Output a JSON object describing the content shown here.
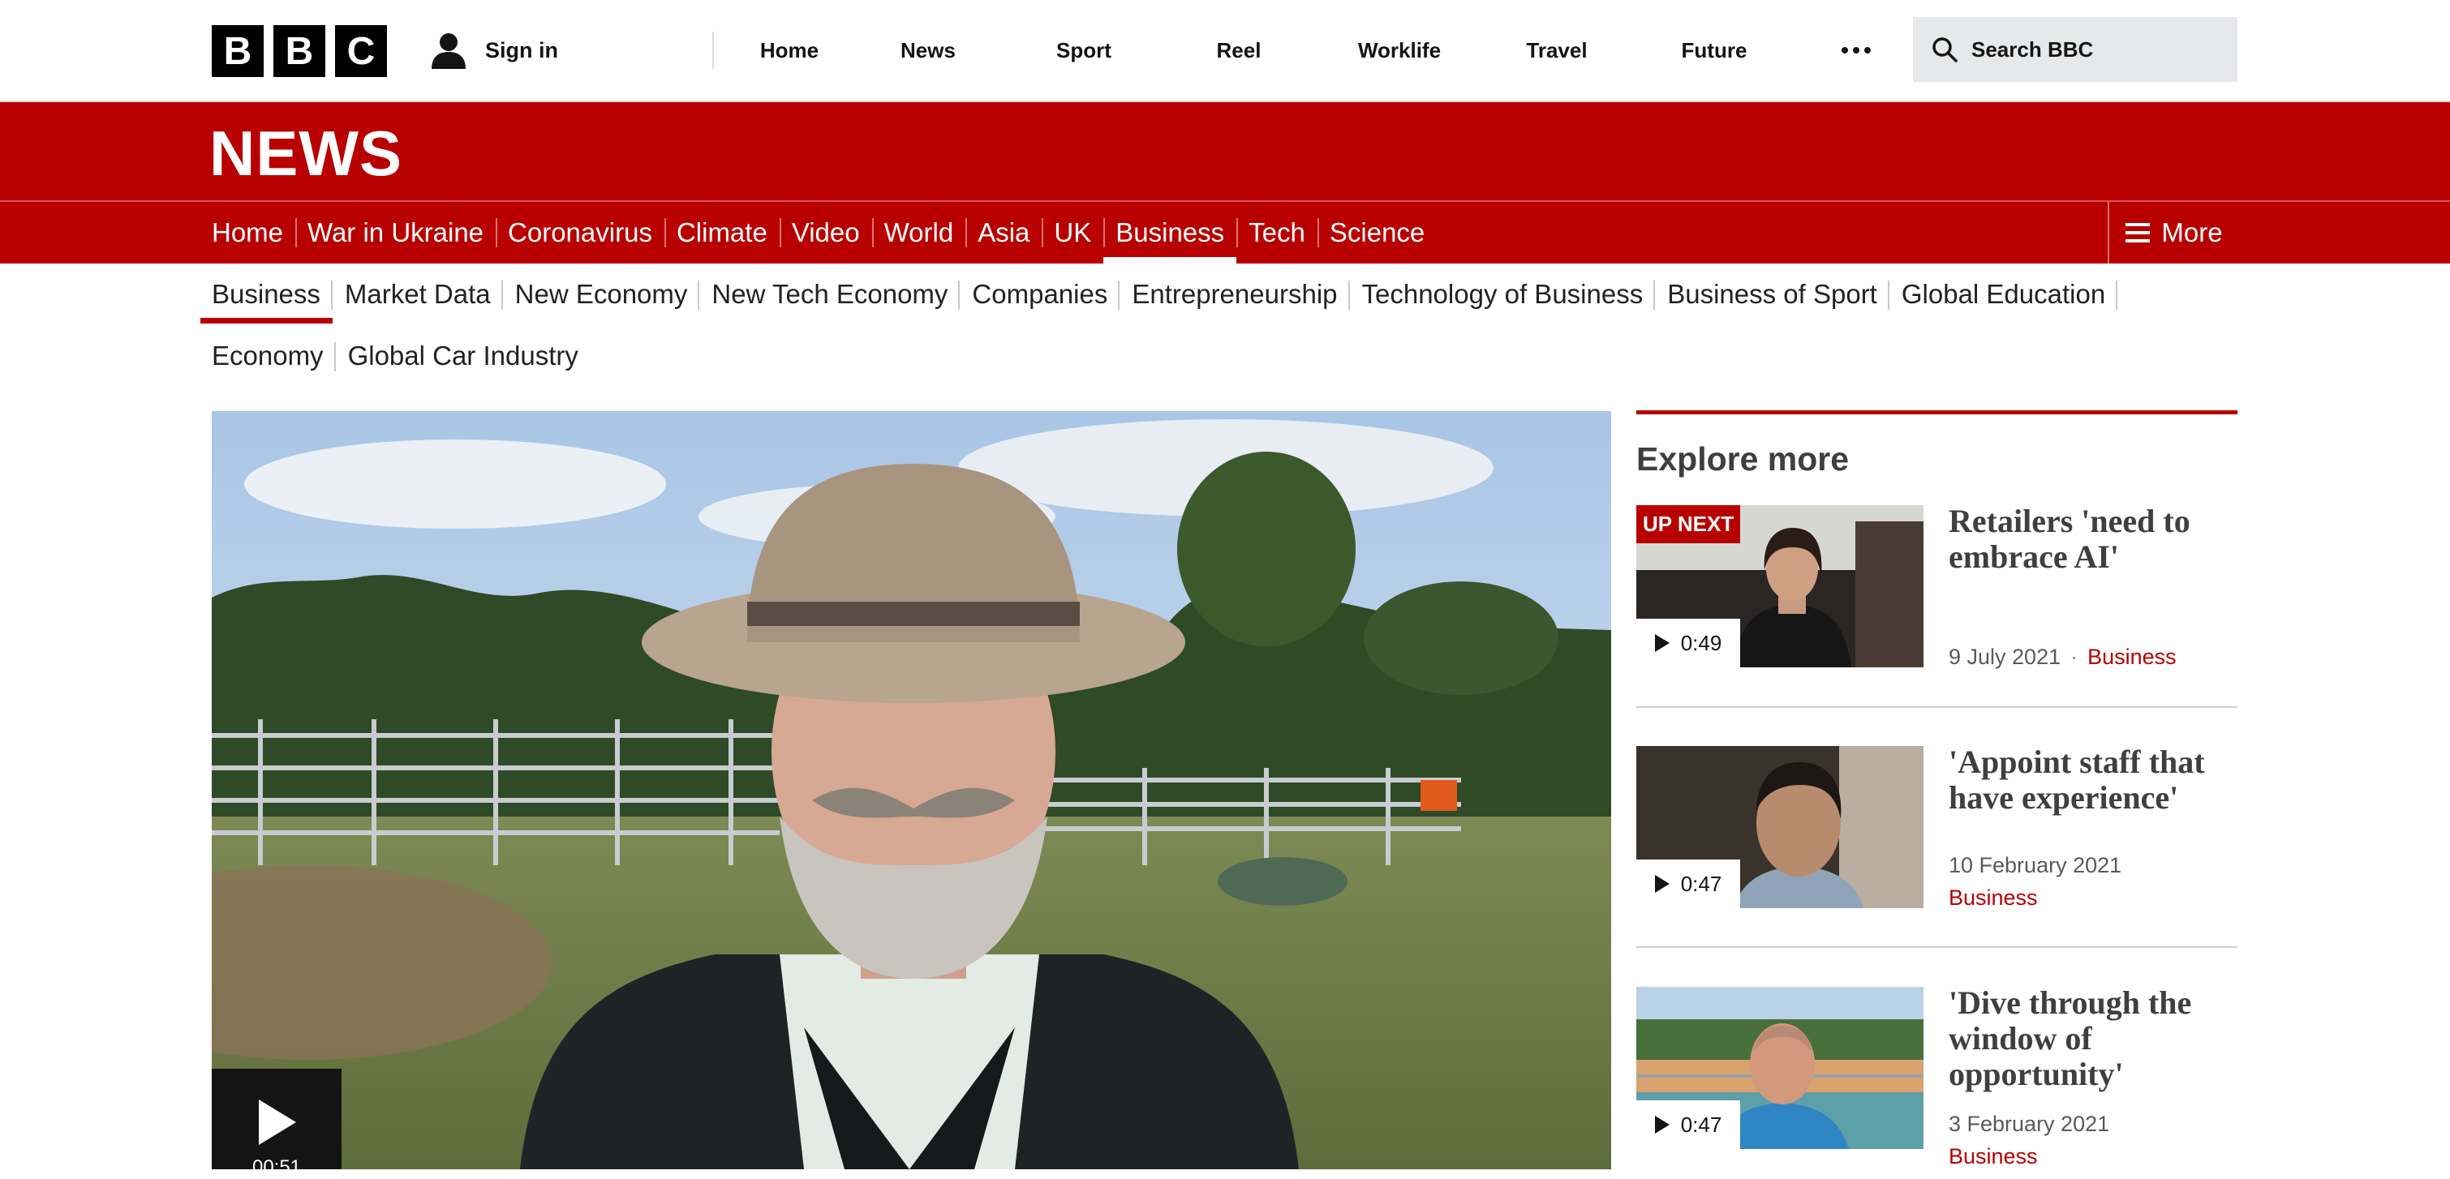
{
  "top_bar": {
    "logo_letters": [
      "B",
      "B",
      "C"
    ],
    "sign_in": "Sign in",
    "nav": [
      "Home",
      "News",
      "Sport",
      "Reel",
      "Worklife",
      "Travel",
      "Future"
    ],
    "search_label": "Search BBC"
  },
  "masthead": {
    "title": "NEWS"
  },
  "main_nav": {
    "items": [
      "Home",
      "War in Ukraine",
      "Coronavirus",
      "Climate",
      "Video",
      "World",
      "Asia",
      "UK",
      "Business",
      "Tech",
      "Science"
    ],
    "active": "Business",
    "more_label": "More"
  },
  "sub_nav": {
    "row1": [
      "Business",
      "Market Data",
      "New Economy",
      "New Tech Economy",
      "Companies",
      "Entrepreneurship",
      "Technology of Business",
      "Business of Sport",
      "Global Education"
    ],
    "row2": [
      "Economy",
      "Global Car Industry"
    ],
    "active": "Business"
  },
  "video": {
    "duration": "00:51"
  },
  "explore": {
    "heading": "Explore more",
    "items": [
      {
        "badge": "UP NEXT",
        "title": "Retailers 'need to embrace AI'",
        "duration": "0:49",
        "date": "9 July 2021",
        "category": "Business"
      },
      {
        "title": "'Appoint staff that have experience'",
        "duration": "0:47",
        "date": "10 February 2021",
        "category": "Business"
      },
      {
        "title": "'Dive through the window of opportunity'",
        "duration": "0:47",
        "date": "3 February 2021",
        "category": "Business"
      }
    ]
  },
  "colors": {
    "brand_red": "#b80000",
    "text_dark": "#202224",
    "search_bg": "#e6e8ea"
  }
}
